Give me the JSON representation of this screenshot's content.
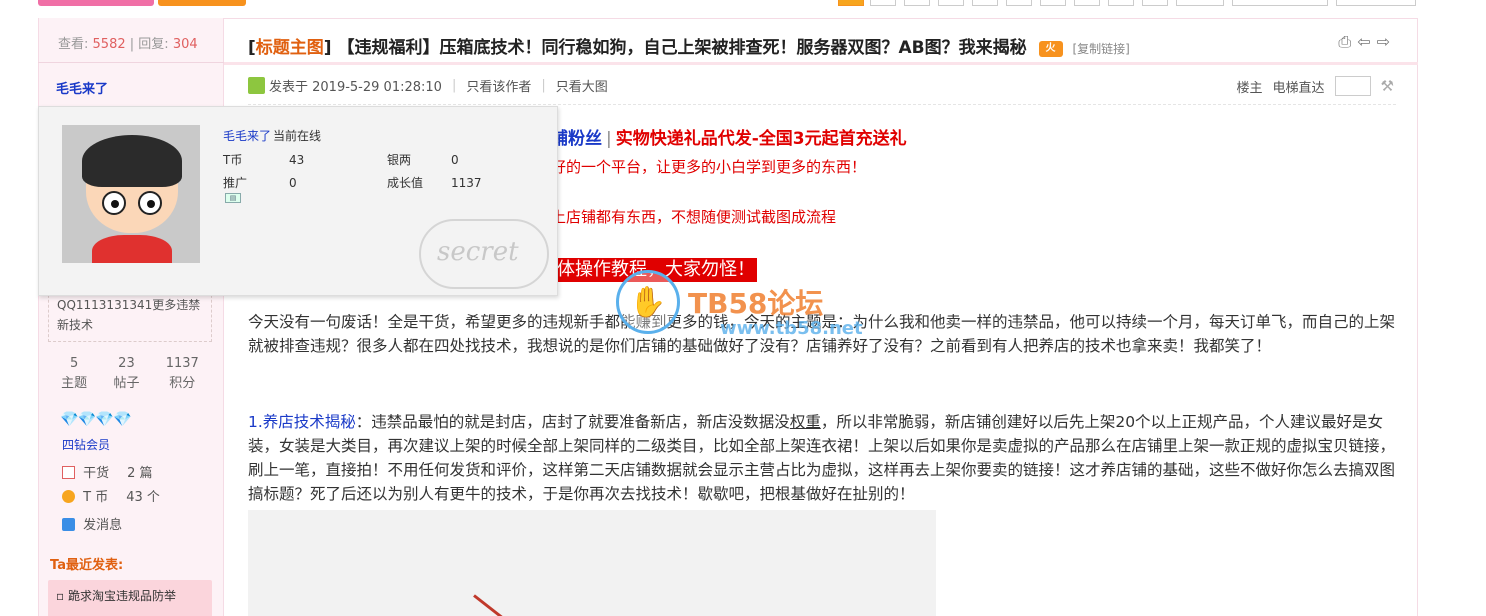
{
  "sidebar": {
    "views_label": "查看:",
    "views": "5582",
    "replies_label": "回复:",
    "replies": "304",
    "author": "毛毛来了",
    "signature": "QQ1113131341更多违禁新技术",
    "stats": [
      {
        "value": "5",
        "label": "主题"
      },
      {
        "value": "23",
        "label": "帖子"
      },
      {
        "value": "1137",
        "label": "积分"
      }
    ],
    "diamonds": "💎💎💎💎",
    "member_level": "四钻会员",
    "ganhuo_label": "干货",
    "ganhuo_value": "2 篇",
    "tcoin_label": "T 币",
    "tcoin_value": "43 个",
    "message": "发消息",
    "recent_title": "Ta最近发表:",
    "recent_item": "跪求淘宝违规品防举"
  },
  "post": {
    "cat_open": "[",
    "category": "标题主图",
    "cat_close": "]",
    "title": "【违规福利】压箱底技术！同行稳如狗，自己上架被排查死！服务器双图？AB图？我来揭秘",
    "hot_badge": "火",
    "copy_link": "[复制链接]",
    "posted_at": "发表于 2019-5-29 01:28:10",
    "only_author": "只看该作者",
    "only_big_image": "只看大图",
    "floor": "楼主",
    "elevator": "电梯直达",
    "promo_blue": "铺粉丝",
    "promo_sep": "|",
    "promo_red": "实物快递礼品代发-全国3元起首充送礼",
    "red_line_1": "好的一个平台，让更多的小白学到更多的东西！",
    "red_line_2": "上店铺都有东西，不想随便测试截图成流程",
    "banner": "体操作教程，大家勿怪！",
    "para_1": "今天没有一句废话！全是干货，希望更多的违规新手都能赚到更多的钱，今天的主题是：为什么我和他卖一样的违禁品，他可以持续一个月，每天订单飞，而自己的上架就被排查违规？很多人都在四处找技术，我想说的是你们店铺的基础做好了没有？店铺养好了没有？之前看到有人把养店的技术也拿来卖！我都笑了！",
    "para_2_label": "1.养店技术揭秘",
    "para_2a": "：违禁品最怕的就是封店，店封了就要准备新店，新店没数据没",
    "para_2_ul": "权重",
    "para_2b": "，所以非常脆弱，新店铺创建好以后先上架20个以上正规产品，个人建议最好是女装，女装是大类目，再次建议上架的时候全部上架同样的二级类目，比如全部上架连衣裙！上架以后如果你是卖虚拟的产品那么在店铺里上架一款正规的虚拟宝贝链接，刷上一笔，直接拍！不用任何发货和评价，这样第二天店铺数据就会显示主营占比为虚拟，这样再去上架你要卖的链接！这才养店铺的基础，这些不做好你怎么去搞双图搞标题？死了后还以为别人有更牛的技术，于是你再次去找技术！歇歇吧，把根基做好在扯别的！"
  },
  "popup": {
    "name": "毛毛来了",
    "status": "当前在线",
    "rows": [
      {
        "k1": "T币",
        "v1": "43",
        "k2": "银两",
        "v2": "0"
      },
      {
        "k1": "推广",
        "v1": "0",
        "k2": "成长值",
        "v2": "1137"
      }
    ],
    "secret": "secret"
  },
  "watermark": {
    "site": "TB58论坛",
    "url": "www.tb58.net"
  }
}
